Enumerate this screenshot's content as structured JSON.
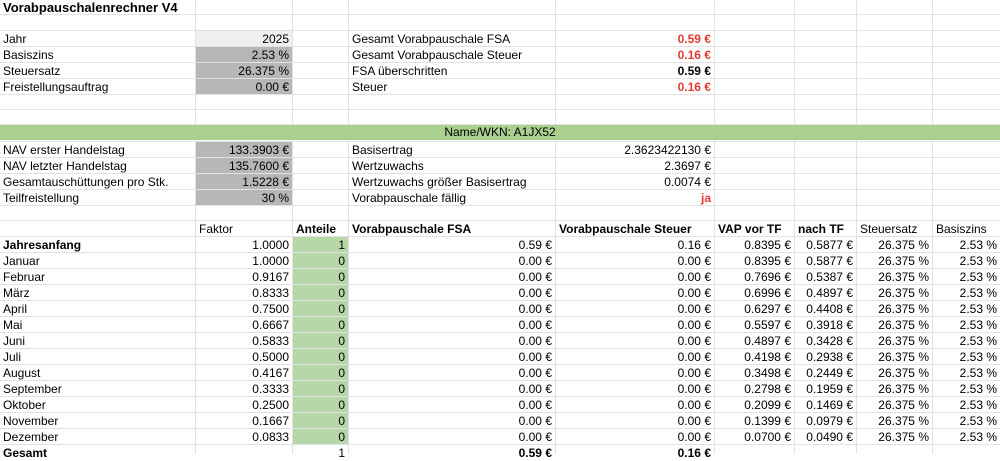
{
  "title": "Vorabpauschalenrechner V4",
  "inputs": [
    {
      "label": "Jahr",
      "value": "2025"
    },
    {
      "label": "Basiszins",
      "value": "2.53 %"
    },
    {
      "label": "Steuersatz",
      "value": "26.375 %"
    },
    {
      "label": "Freistellungsauftrag",
      "value": "0.00 €"
    }
  ],
  "summary": [
    {
      "label": "Gesamt Vorabpauschale FSA",
      "value": "0.59 €"
    },
    {
      "label": "Gesamt Vorabpauschale Steuer",
      "value": "0.16 €"
    },
    {
      "label": "FSA überschritten",
      "value": "0.59 €"
    },
    {
      "label": "Steuer",
      "value": "0.16 €"
    }
  ],
  "fund_header": "Name/WKN: A1JX52",
  "fund_inputs": [
    {
      "label": "NAV erster Handelstag",
      "value": "133.3903 €"
    },
    {
      "label": "NAV letzter Handelstag",
      "value": "135.7600 €"
    },
    {
      "label": "Gesamtauschüttungen pro Stk.",
      "value": "1.5228 €"
    },
    {
      "label": "Teilfreistellung",
      "value": "30 %"
    }
  ],
  "fund_results": [
    {
      "label": "Basisertrag",
      "value": "2.3623422130 €"
    },
    {
      "label": "Wertzuwachs",
      "value": "2.3697 €"
    },
    {
      "label": "Wertzuwachs größer Basisertrag",
      "value": "0.0074 €"
    },
    {
      "label": "Vorabpauschale fällig",
      "value": "ja"
    }
  ],
  "table": {
    "headers": [
      "Faktor",
      "Anteile",
      "Vorabpauschale FSA",
      "Vorabpauschale Steuer",
      "VAP vor TF",
      "nach TF",
      "Steuersatz",
      "Basiszins"
    ],
    "rows": [
      {
        "month": "Jahresanfang",
        "faktor": "1.0000",
        "anteile": "1",
        "fsa": "0.59 €",
        "steuer": "0.16 €",
        "vap": "0.8395 €",
        "nach": "0.5877 €",
        "satz": "26.375 %",
        "zins": "2.53 %"
      },
      {
        "month": "Januar",
        "faktor": "1.0000",
        "anteile": "0",
        "fsa": "0.00 €",
        "steuer": "0.00 €",
        "vap": "0.8395 €",
        "nach": "0.5877 €",
        "satz": "26.375 %",
        "zins": "2.53 %"
      },
      {
        "month": "Februar",
        "faktor": "0.9167",
        "anteile": "0",
        "fsa": "0.00 €",
        "steuer": "0.00 €",
        "vap": "0.7696 €",
        "nach": "0.5387 €",
        "satz": "26.375 %",
        "zins": "2.53 %"
      },
      {
        "month": "März",
        "faktor": "0.8333",
        "anteile": "0",
        "fsa": "0.00 €",
        "steuer": "0.00 €",
        "vap": "0.6996 €",
        "nach": "0.4897 €",
        "satz": "26.375 %",
        "zins": "2.53 %"
      },
      {
        "month": "April",
        "faktor": "0.7500",
        "anteile": "0",
        "fsa": "0.00 €",
        "steuer": "0.00 €",
        "vap": "0.6297 €",
        "nach": "0.4408 €",
        "satz": "26.375 %",
        "zins": "2.53 %"
      },
      {
        "month": "Mai",
        "faktor": "0.6667",
        "anteile": "0",
        "fsa": "0.00 €",
        "steuer": "0.00 €",
        "vap": "0.5597 €",
        "nach": "0.3918 €",
        "satz": "26.375 %",
        "zins": "2.53 %"
      },
      {
        "month": "Juni",
        "faktor": "0.5833",
        "anteile": "0",
        "fsa": "0.00 €",
        "steuer": "0.00 €",
        "vap": "0.4897 €",
        "nach": "0.3428 €",
        "satz": "26.375 %",
        "zins": "2.53 %"
      },
      {
        "month": "Juli",
        "faktor": "0.5000",
        "anteile": "0",
        "fsa": "0.00 €",
        "steuer": "0.00 €",
        "vap": "0.4198 €",
        "nach": "0.2938 €",
        "satz": "26.375 %",
        "zins": "2.53 %"
      },
      {
        "month": "August",
        "faktor": "0.4167",
        "anteile": "0",
        "fsa": "0.00 €",
        "steuer": "0.00 €",
        "vap": "0.3498 €",
        "nach": "0.2449 €",
        "satz": "26.375 %",
        "zins": "2.53 %"
      },
      {
        "month": "September",
        "faktor": "0.3333",
        "anteile": "0",
        "fsa": "0.00 €",
        "steuer": "0.00 €",
        "vap": "0.2798 €",
        "nach": "0.1959 €",
        "satz": "26.375 %",
        "zins": "2.53 %"
      },
      {
        "month": "Oktober",
        "faktor": "0.2500",
        "anteile": "0",
        "fsa": "0.00 €",
        "steuer": "0.00 €",
        "vap": "0.2099 €",
        "nach": "0.1469 €",
        "satz": "26.375 %",
        "zins": "2.53 %"
      },
      {
        "month": "November",
        "faktor": "0.1667",
        "anteile": "0",
        "fsa": "0.00 €",
        "steuer": "0.00 €",
        "vap": "0.1399 €",
        "nach": "0.0979 €",
        "satz": "26.375 %",
        "zins": "2.53 %"
      },
      {
        "month": "Dezember",
        "faktor": "0.0833",
        "anteile": "0",
        "fsa": "0.00 €",
        "steuer": "0.00 €",
        "vap": "0.0700 €",
        "nach": "0.0490 €",
        "satz": "26.375 %",
        "zins": "2.53 %"
      }
    ],
    "total": {
      "label": "Gesamt",
      "anteile": "1",
      "fsa": "0.59 €",
      "steuer": "0.16 €"
    }
  }
}
